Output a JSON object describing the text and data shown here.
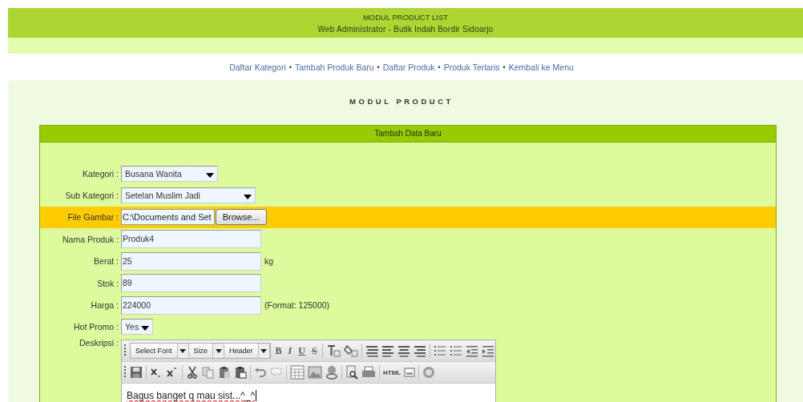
{
  "header": {
    "title": "MODUL PRODUCT LIST",
    "subtitle": "Web Administrator - Butik Indah Bordir Sidoarjo"
  },
  "nav": [
    {
      "label": "Daftar Kategori"
    },
    {
      "label": "Tambah Produk Baru"
    },
    {
      "label": "Daftar Produk"
    },
    {
      "label": "Produk Terlaris"
    },
    {
      "label": "Kembali ke Menu"
    }
  ],
  "nav_separator": "•",
  "page_title": "MODUL PRODUCT",
  "form": {
    "title": "Tambah Data Baru",
    "fields": [
      {
        "kind": "select",
        "label": "Kategori :",
        "value": "Busana Wanita",
        "highlighted": false
      },
      {
        "kind": "select",
        "label": "Sub Kategori :",
        "value": "Setelan Muslim Jadi",
        "highlighted": false
      },
      {
        "kind": "file",
        "label": "File Gambar :",
        "value": "C:\\Documents and Set",
        "button": "Browse...",
        "highlighted": true
      },
      {
        "kind": "text",
        "label": "Nama Produk :",
        "value": "Produk4",
        "highlighted": false
      },
      {
        "kind": "text",
        "label": "Berat :",
        "value": "25",
        "note": "kg",
        "highlighted": false
      },
      {
        "kind": "text",
        "label": "Stok :",
        "value": "89",
        "highlighted": false
      },
      {
        "kind": "text",
        "label": "Harga :",
        "value": "224000",
        "note": "(Format: 125000)",
        "highlighted": false
      },
      {
        "kind": "select",
        "label": "Hot Promo :",
        "value": "Yes",
        "highlighted": false
      },
      {
        "kind": "editor",
        "label": "Deskripsi :",
        "value": "Bagus banget q mau sist...^_^",
        "highlighted": false
      }
    ],
    "editor_toolbar": {
      "dropdowns": [
        {
          "label": "Select Font"
        },
        {
          "label": "Size"
        },
        {
          "label": "Header"
        }
      ],
      "format_buttons": [
        {
          "label": "B"
        },
        {
          "label": "I"
        },
        {
          "label": "U"
        },
        {
          "label": "S"
        }
      ],
      "html_button": "HTML"
    }
  }
}
